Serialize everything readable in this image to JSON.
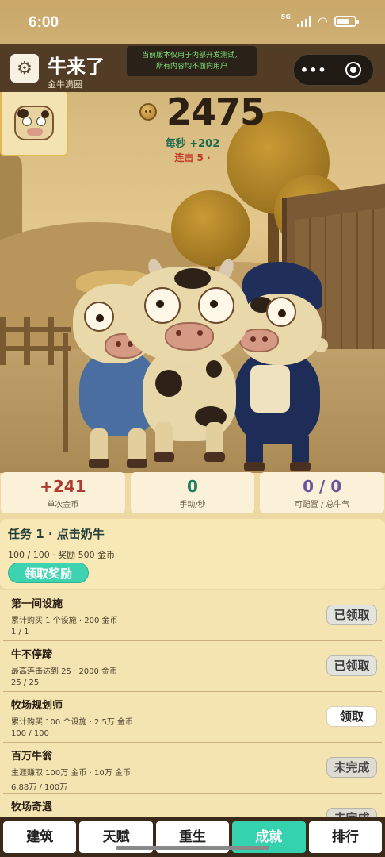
{
  "status_bar": {
    "time": "6:00",
    "network": "5G"
  },
  "header": {
    "title": "牛来了",
    "subtitle": "金牛满圈",
    "dev_notice_line1": "当前版本仅用于内部开发测试，",
    "dev_notice_line2": "所有内容均不面向用户",
    "capsule_more": "•••"
  },
  "icons": {
    "settings": "gear-icon",
    "coin": "coin-icon",
    "close": "record-circle-icon"
  },
  "coins": {
    "count": "2475",
    "per_second": "每秒 +202",
    "combo_label": "连击 5 · ",
    "combo_extra": ""
  },
  "stats": [
    {
      "value": "+241",
      "label": "单次金币"
    },
    {
      "value": "0",
      "label": "手动/秒"
    },
    {
      "value": "0 / 0",
      "label": "可配置 / 总牛气"
    }
  ],
  "task": {
    "title": "任务 1 · 点击奶牛",
    "meta": "100 / 100 · 奖励 500 金币",
    "claim_label": "领取奖励"
  },
  "achievements": [
    {
      "name": "第一间设施",
      "desc": "累计购买 1 个设施 · 200 金币",
      "progress": "1 / 1",
      "button": "已领取",
      "state": "done"
    },
    {
      "name": "牛不停蹄",
      "desc": "最高连击达到 25 · 2000 金币",
      "progress": "25 / 25",
      "button": "已领取",
      "state": "done"
    },
    {
      "name": "牧场规划师",
      "desc": "累计购买 100 个设施 · 2.5万 金币",
      "progress": "100 / 100",
      "button": "领取",
      "state": "ready"
    },
    {
      "name": "百万牛翁",
      "desc": "生涯赚取 100万 金币 · 10万 金币",
      "progress": "6.88万 / 100万",
      "button": "未完成",
      "state": "pending"
    },
    {
      "name": "牧场奇遇",
      "desc": "",
      "progress": "",
      "button": "未完成",
      "state": "pending"
    }
  ],
  "nav": [
    {
      "label": "建筑",
      "active": false
    },
    {
      "label": "天赋",
      "active": false
    },
    {
      "label": "重生",
      "active": false
    },
    {
      "label": "成就",
      "active": true
    },
    {
      "label": "排行",
      "active": false
    }
  ],
  "colors": {
    "accent": "#35d2b0",
    "header_bg": "#46321e",
    "combo": "#c23a2c",
    "per_second": "#1f6b52"
  }
}
